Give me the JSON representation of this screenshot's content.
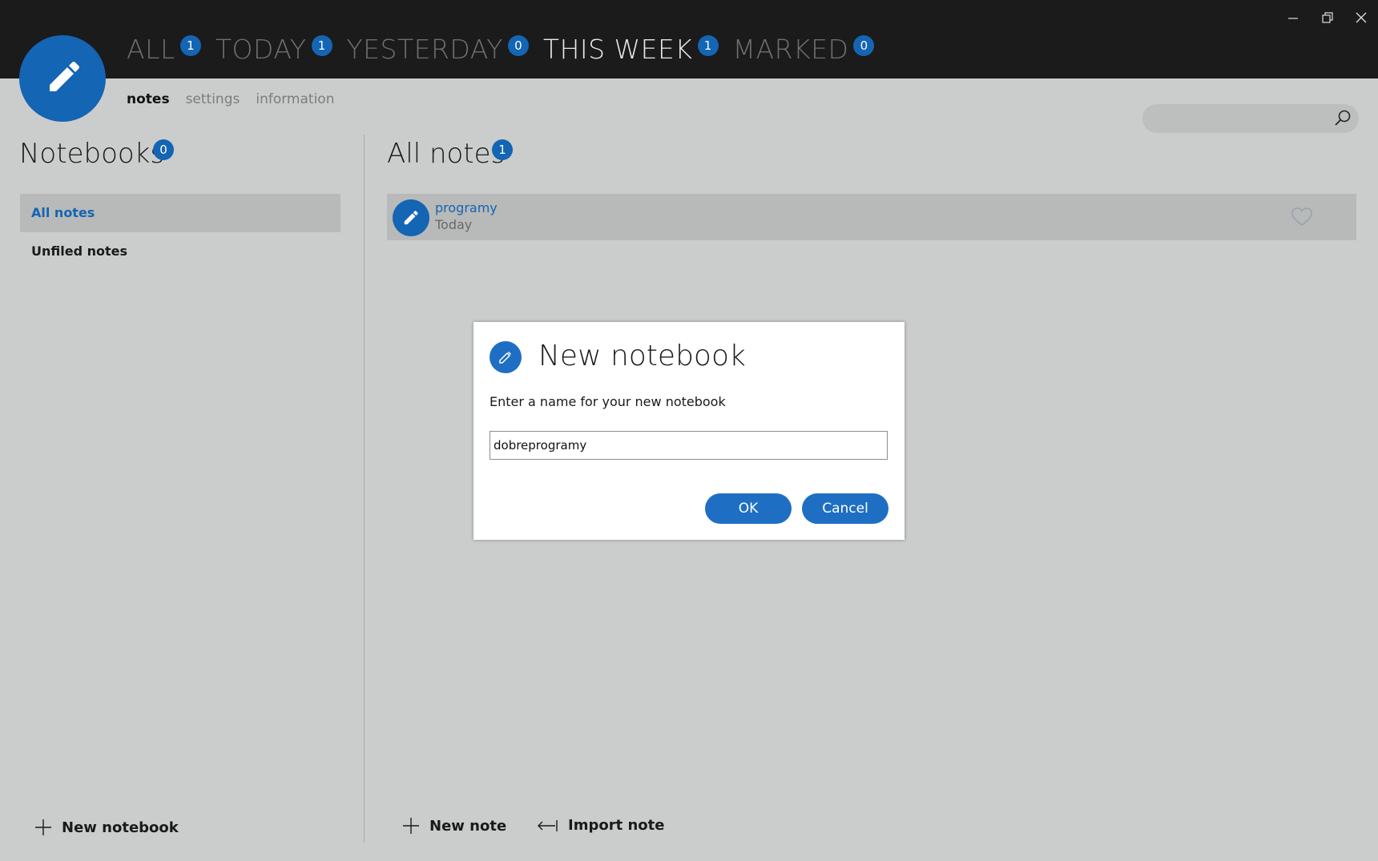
{
  "window": {
    "controls": [
      "minimize-icon",
      "restore-icon",
      "close-icon"
    ]
  },
  "filters": [
    {
      "label": "ALL",
      "count": "1",
      "active": false
    },
    {
      "label": "TODAY",
      "count": "1",
      "active": false
    },
    {
      "label": "YESTERDAY",
      "count": "0",
      "active": false
    },
    {
      "label": "THIS WEEK",
      "count": "1",
      "active": true
    },
    {
      "label": "MARKED",
      "count": "0",
      "active": false
    }
  ],
  "subnav": {
    "notes": "notes",
    "settings": "settings",
    "information": "information",
    "active": "notes"
  },
  "search": {
    "placeholder": "",
    "icon": "search-icon"
  },
  "notebooks": {
    "title": "Notebooks",
    "count": "0",
    "items": [
      "All notes",
      "Unfiled notes"
    ],
    "selected": "All notes",
    "new_label": "New notebook"
  },
  "notes": {
    "title": "All notes",
    "count": "1",
    "items": [
      {
        "title": "programy",
        "date": "Today",
        "icon": "pencil-icon",
        "fav_icon": "heart-icon"
      }
    ],
    "new_label": "New note",
    "import_label": "Import note"
  },
  "dialog": {
    "title": "New notebook",
    "prompt": "Enter a name for your new notebook",
    "input_value": "dobreprogramy",
    "ok_label": "OK",
    "cancel_label": "Cancel"
  },
  "colors": {
    "accent": "#1465b3",
    "button": "#1e6fc4",
    "titlebar": "#1b1b1b",
    "background": "#cbcccc"
  }
}
